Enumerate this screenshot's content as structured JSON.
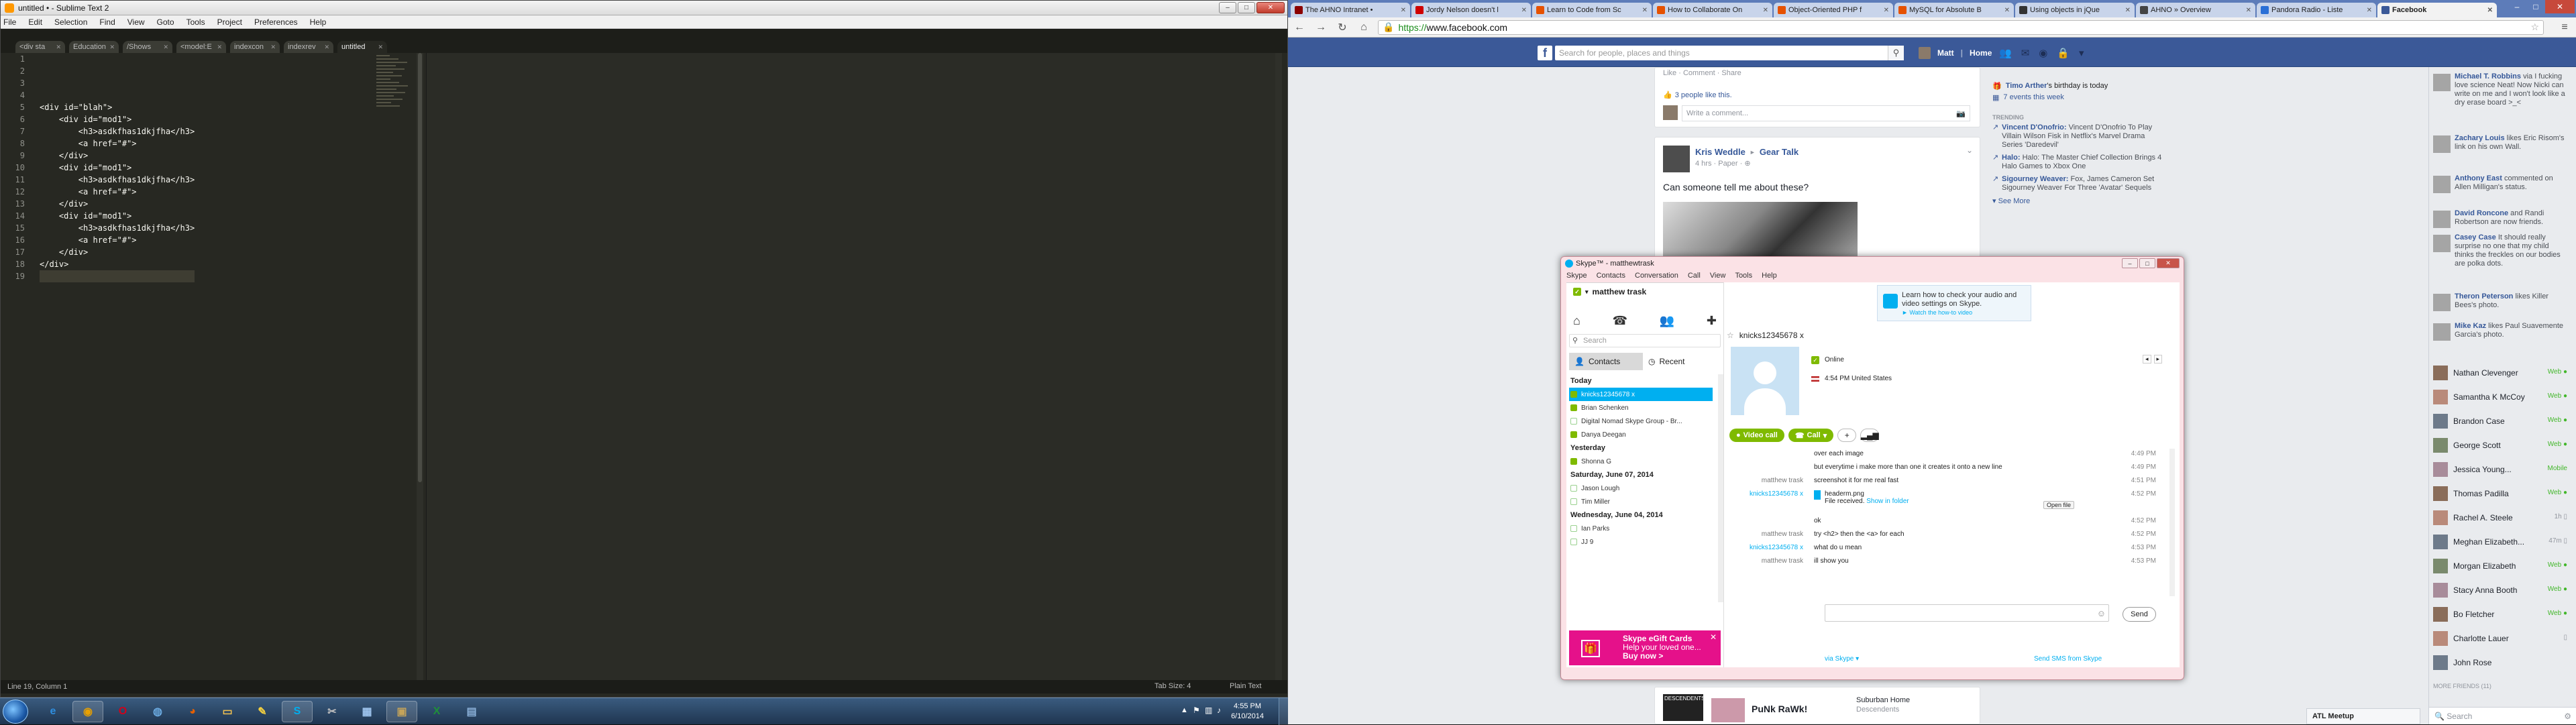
{
  "sublime": {
    "title": "untitled • - Sublime Text 2",
    "menu": [
      "File",
      "Edit",
      "Selection",
      "Find",
      "View",
      "Goto",
      "Tools",
      "Project",
      "Preferences",
      "Help"
    ],
    "tabs": [
      "<div sta",
      "Education",
      "/Shows",
      "<model:E",
      "indexcon",
      "indexrev",
      "untitled"
    ],
    "line_numbers": [
      "1",
      "2",
      "3",
      "4",
      "5",
      "6",
      "7",
      "8",
      "9",
      "10",
      "11",
      "12",
      "13",
      "14",
      "15",
      "16",
      "17",
      "18",
      "19"
    ],
    "code_lines": [
      "",
      "",
      "",
      "",
      "<div id=\"blah\">",
      "    <div id=\"mod1\">",
      "        <h3>asdkfhas1dkjfha</h3>",
      "        <a href=\"#\">",
      "    </div>",
      "    <div id=\"mod1\">",
      "        <h3>asdkfhas1dkjfha</h3>",
      "        <a href=\"#\">",
      "    </div>",
      "    <div id=\"mod1\">",
      "        <h3>asdkfhas1dkjfha</h3>",
      "        <a href=\"#\">",
      "    </div>",
      "</div>",
      ""
    ],
    "status_left": "Line 19, Column 1",
    "tab_size": "Tab Size: 4",
    "syntax": "Plain Text"
  },
  "taskbar": {
    "apps": [
      {
        "name": "ie",
        "glyph": "e",
        "color": "#2e8ee0"
      },
      {
        "name": "chrome",
        "glyph": "◉",
        "color": "#e8a000",
        "active": true
      },
      {
        "name": "opera",
        "glyph": "O",
        "color": "#d0021b"
      },
      {
        "name": "globe",
        "glyph": "◍",
        "color": "#6aa9df"
      },
      {
        "name": "firefox",
        "glyph": "◕",
        "color": "#e66000"
      },
      {
        "name": "explorer",
        "glyph": "▭",
        "color": "#f0c050"
      },
      {
        "name": "sticky",
        "glyph": "✎",
        "color": "#f4d03f"
      },
      {
        "name": "skype",
        "glyph": "S",
        "color": "#00aff0",
        "active": true
      },
      {
        "name": "tools",
        "glyph": "✂",
        "color": "#c0c0c0"
      },
      {
        "name": "network",
        "glyph": "▦",
        "color": "#9fc5ef"
      },
      {
        "name": "media",
        "glyph": "▣",
        "color": "#c4a35a",
        "active": true
      },
      {
        "name": "excel",
        "glyph": "X",
        "color": "#1f8f3a"
      },
      {
        "name": "display",
        "glyph": "▤",
        "color": "#8ab0d8"
      }
    ],
    "time": "4:55 PM",
    "date": "6/10/2014"
  },
  "chrome": {
    "tabs": [
      {
        "title": "The AHNO Intranet •",
        "color": "#8b0000"
      },
      {
        "title": "Jordy Nelson doesn't l",
        "color": "#d00000"
      },
      {
        "title": "Learn to Code from Sc",
        "color": "#e65100"
      },
      {
        "title": "How to Collaborate On",
        "color": "#e65100"
      },
      {
        "title": "Object-Oriented PHP f",
        "color": "#e65100"
      },
      {
        "title": "MySQL for Absolute B",
        "color": "#e65100"
      },
      {
        "title": "Using objects in jQue",
        "color": "#333333"
      },
      {
        "title": "AHNO » Overview",
        "color": "#444444"
      },
      {
        "title": "Pandora Radio - Liste",
        "color": "#2a6fd6"
      },
      {
        "title": "Facebook",
        "color": "#3b5998"
      }
    ],
    "url_scheme": "https://",
    "url_host": "www.facebook.com"
  },
  "facebook": {
    "search_placeholder": "Search for people, places and things",
    "user": "Matt",
    "home": "Home",
    "post_actions": "Like · Comment · Share",
    "likes": "3 people like this.",
    "comment_placeholder": "Write a comment...",
    "post_author": "Kris Weddle",
    "post_arrow": "►",
    "post_group": "Gear Talk",
    "post_meta": "4 hrs · Paper · ⊕",
    "post_text": "Can someone tell me about these?",
    "birthday_name": "Timo Arther",
    "birthday_text": "'s birthday is today",
    "events": "7 events this week",
    "trending_label": "TRENDING",
    "trending": [
      {
        "name": "Vincent D'Onofrio:",
        "text": "Vincent D'Onofrio To Play Villain Wilson Fisk in Netflix's Marvel Drama Series 'Daredevil'"
      },
      {
        "name": "Halo:",
        "text": "Halo: The Master Chief Collection Brings 4 Halo Games to Xbox One"
      },
      {
        "name": "Sigourney Weaver:",
        "text": "Fox, James Cameron Set Sigourney Weaver For Three 'Avatar' Sequels"
      }
    ],
    "see_more": "▾ See More",
    "ticker": [
      {
        "name": "Michael T. Robbins",
        "text": " via I fucking love science Neat! Now Nicki can write on me and I won't look like a dry erase board >_<"
      },
      {
        "name": "Zachary Louis",
        "text": " likes Eric Risom's link on his own Wall."
      },
      {
        "name": "Anthony East",
        "text": " commented on Allen Milligan's status."
      },
      {
        "name": "David Roncone",
        "text": " and Randi Robertson are now friends."
      },
      {
        "name": "Casey Case",
        "text": " It should really surprise no one that my child thinks the freckles on our bodies are polka dots."
      },
      {
        "name": "Theron Peterson",
        "text": " likes Killer Bees's photo."
      },
      {
        "name": "Mike Kaz",
        "text": " likes Paul Suavemente Garcia's photo."
      }
    ],
    "friends": [
      {
        "name": "Nathan Clevenger",
        "status": "Web ●"
      },
      {
        "name": "Samantha K McCoy",
        "status": "Web ●"
      },
      {
        "name": "Brandon Case",
        "status": "Web ●"
      },
      {
        "name": "George Scott",
        "status": "Web ●"
      },
      {
        "name": "Jessica Young...",
        "status": "Mobile"
      },
      {
        "name": "Thomas Padilla",
        "status": "Web ●"
      },
      {
        "name": "Rachel A. Steele",
        "status": "1h ▯"
      },
      {
        "name": "Meghan Elizabeth...",
        "status": "47m ▯"
      },
      {
        "name": "Morgan Elizabeth",
        "status": "Web ●"
      },
      {
        "name": "Stacy Anna Booth",
        "status": "Web ●"
      },
      {
        "name": "Bo Fletcher",
        "status": "Web ●"
      },
      {
        "name": "Charlotte Lauer",
        "status": "▯"
      },
      {
        "name": "John Rose",
        "status": ""
      }
    ],
    "more_friends": "MORE FRIENDS (11)",
    "ticker_search": "🔍 Search",
    "atl_meetup": "ATL Meetup",
    "bottom_page": "PuNk RaWk!",
    "bottom_page2": "Suburban Home",
    "bottom_page2_sub": "Descendents"
  },
  "skype": {
    "title": "Skype™ - matthewtrask",
    "menu": [
      "Skype",
      "Contacts",
      "Conversation",
      "Call",
      "View",
      "Tools",
      "Help"
    ],
    "user": "matthew trask",
    "search_placeholder": "Search",
    "tab_contacts": "Contacts",
    "tab_recent": "Recent",
    "groups": [
      {
        "header": "Today",
        "items": [
          {
            "name": "knicks12345678 x",
            "selected": true
          },
          {
            "name": "Brian Schenken"
          },
          {
            "name": "Digital Nomad Skype Group - Br...",
            "offline": true
          },
          {
            "name": "Danya Deegan"
          }
        ]
      },
      {
        "header": "Yesterday",
        "items": [
          {
            "name": "Shonna G"
          }
        ]
      },
      {
        "header": "Saturday, June 07, 2014",
        "items": [
          {
            "name": "Jason Lough",
            "offline": true
          },
          {
            "name": "Tim Miller",
            "offline": true
          }
        ]
      },
      {
        "header": "Wednesday, June 04, 2014",
        "items": [
          {
            "name": "Ian Parks",
            "offline": true
          },
          {
            "name": "JJ 9",
            "offline": true
          }
        ]
      }
    ],
    "ad_title": "Skype eGift Cards",
    "ad_line2": "Help your loved one...",
    "ad_line3": "Buy now >",
    "banner_text": "Learn how to check your audio and video settings on Skype.",
    "banner_link": "► Watch the how-to video",
    "contact_name": "knicks12345678 x",
    "contact_status": "Online",
    "contact_location": "4:54 PM United States",
    "btn_video": "Video call",
    "btn_call": "Call",
    "messages": [
      {
        "sender": "",
        "text": "over each image",
        "time": "4:49 PM"
      },
      {
        "sender": "",
        "text": "but everytime i make more than one it creates it onto a new line",
        "time": "4:49 PM"
      },
      {
        "sender": "matthew trask",
        "text": "screenshot it for me real fast",
        "time": "4:51 PM"
      },
      {
        "sender": "knicks12345678 x",
        "text": "headerm.png",
        "time": "4:52 PM",
        "file": true
      },
      {
        "sender": "",
        "text": "ok",
        "time": "4:52 PM"
      },
      {
        "sender": "matthew trask",
        "text": "try <h2> then the <a> for each",
        "time": "4:52 PM"
      },
      {
        "sender": "knicks12345678 x",
        "text": "what do u mean",
        "time": "4:53 PM"
      },
      {
        "sender": "matthew trask",
        "text": "ill show you",
        "time": "4:53 PM"
      }
    ],
    "file_received": "File received.",
    "show_in_folder": "Show in folder",
    "open_file": "Open file",
    "send": "Send",
    "via": "via Skype ▾",
    "sms": "Send SMS from Skype"
  }
}
